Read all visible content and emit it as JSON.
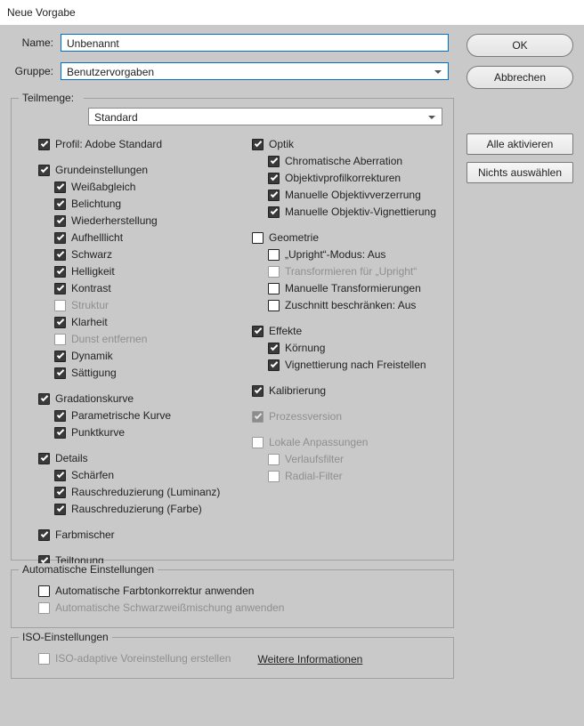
{
  "title": "Neue Vorgabe",
  "labels": {
    "name": "Name:",
    "group": "Gruppe:",
    "subset": "Teilmenge:"
  },
  "fields": {
    "name_value": "Unbenannt",
    "group_value": "Benutzervorgaben",
    "subset_value": "Standard"
  },
  "buttons": {
    "ok": "OK",
    "cancel": "Abbrechen",
    "activate_all": "Alle aktivieren",
    "select_none": "Nichts auswählen"
  },
  "tree_left": [
    {
      "label": "Profil: Adobe Standard",
      "indent": 1,
      "checked": true,
      "enabled": true
    },
    {
      "gap": true
    },
    {
      "label": "Grundeinstellungen",
      "indent": 1,
      "checked": true,
      "enabled": true
    },
    {
      "label": "Weißabgleich",
      "indent": 2,
      "checked": true,
      "enabled": true
    },
    {
      "label": "Belichtung",
      "indent": 2,
      "checked": true,
      "enabled": true
    },
    {
      "label": "Wiederherstellung",
      "indent": 2,
      "checked": true,
      "enabled": true
    },
    {
      "label": "Aufhelllicht",
      "indent": 2,
      "checked": true,
      "enabled": true
    },
    {
      "label": "Schwarz",
      "indent": 2,
      "checked": true,
      "enabled": true
    },
    {
      "label": "Helligkeit",
      "indent": 2,
      "checked": true,
      "enabled": true
    },
    {
      "label": "Kontrast",
      "indent": 2,
      "checked": true,
      "enabled": true
    },
    {
      "label": "Struktur",
      "indent": 2,
      "checked": false,
      "enabled": false
    },
    {
      "label": "Klarheit",
      "indent": 2,
      "checked": true,
      "enabled": true
    },
    {
      "label": "Dunst entfernen",
      "indent": 2,
      "checked": false,
      "enabled": false
    },
    {
      "label": "Dynamik",
      "indent": 2,
      "checked": true,
      "enabled": true
    },
    {
      "label": "Sättigung",
      "indent": 2,
      "checked": true,
      "enabled": true
    },
    {
      "gap": true
    },
    {
      "label": "Gradationskurve",
      "indent": 1,
      "checked": true,
      "enabled": true
    },
    {
      "label": "Parametrische Kurve",
      "indent": 2,
      "checked": true,
      "enabled": true
    },
    {
      "label": "Punktkurve",
      "indent": 2,
      "checked": true,
      "enabled": true
    },
    {
      "gap": true
    },
    {
      "label": "Details",
      "indent": 1,
      "checked": true,
      "enabled": true
    },
    {
      "label": "Schärfen",
      "indent": 2,
      "checked": true,
      "enabled": true
    },
    {
      "label": "Rauschreduzierung (Luminanz)",
      "indent": 2,
      "checked": true,
      "enabled": true
    },
    {
      "label": "Rauschreduzierung (Farbe)",
      "indent": 2,
      "checked": true,
      "enabled": true
    },
    {
      "gap": true
    },
    {
      "label": "Farbmischer",
      "indent": 1,
      "checked": true,
      "enabled": true
    },
    {
      "gap": true
    },
    {
      "label": "Teiltonung",
      "indent": 1,
      "checked": true,
      "enabled": true
    }
  ],
  "tree_right": [
    {
      "label": "Optik",
      "indent": 1,
      "checked": true,
      "enabled": true
    },
    {
      "label": "Chromatische Aberration",
      "indent": 2,
      "checked": true,
      "enabled": true
    },
    {
      "label": "Objektivprofilkorrekturen",
      "indent": 2,
      "checked": true,
      "enabled": true
    },
    {
      "label": "Manuelle Objektivverzerrung",
      "indent": 2,
      "checked": true,
      "enabled": true
    },
    {
      "label": "Manuelle Objektiv-Vignettierung",
      "indent": 2,
      "checked": true,
      "enabled": true
    },
    {
      "gap": true
    },
    {
      "label": "Geometrie",
      "indent": 1,
      "checked": false,
      "enabled": true
    },
    {
      "label": "„Upright“-Modus: Aus",
      "indent": 2,
      "checked": false,
      "enabled": true
    },
    {
      "label": "Transformieren für „Upright“",
      "indent": 2,
      "checked": false,
      "enabled": false
    },
    {
      "label": "Manuelle Transformierungen",
      "indent": 2,
      "checked": false,
      "enabled": true
    },
    {
      "label": "Zuschnitt beschränken: Aus",
      "indent": 2,
      "checked": false,
      "enabled": true
    },
    {
      "gap": true
    },
    {
      "label": "Effekte",
      "indent": 1,
      "checked": true,
      "enabled": true
    },
    {
      "label": "Körnung",
      "indent": 2,
      "checked": true,
      "enabled": true
    },
    {
      "label": "Vignettierung nach Freistellen",
      "indent": 2,
      "checked": true,
      "enabled": true
    },
    {
      "gap": true
    },
    {
      "label": "Kalibrierung",
      "indent": 1,
      "checked": true,
      "enabled": true
    },
    {
      "gap": true
    },
    {
      "label": "Prozessversion",
      "indent": 1,
      "checked": true,
      "enabled": false
    },
    {
      "gap": true
    },
    {
      "label": "Lokale Anpassungen",
      "indent": 1,
      "checked": false,
      "enabled": false
    },
    {
      "label": "Verlaufsfilter",
      "indent": 2,
      "checked": false,
      "enabled": false
    },
    {
      "label": "Radial-Filter",
      "indent": 2,
      "checked": false,
      "enabled": false
    }
  ],
  "auto_settings": {
    "title": "Automatische Einstellungen",
    "opt1": {
      "label": "Automatische Farbtonkorrektur anwenden",
      "checked": false,
      "enabled": true
    },
    "opt2": {
      "label": "Automatische Schwarzweißmischung anwenden",
      "checked": false,
      "enabled": false
    }
  },
  "iso_settings": {
    "title": "ISO-Einstellungen",
    "opt": {
      "label": "ISO-adaptive Voreinstellung erstellen",
      "checked": false,
      "enabled": false
    },
    "link": "Weitere Informationen"
  }
}
